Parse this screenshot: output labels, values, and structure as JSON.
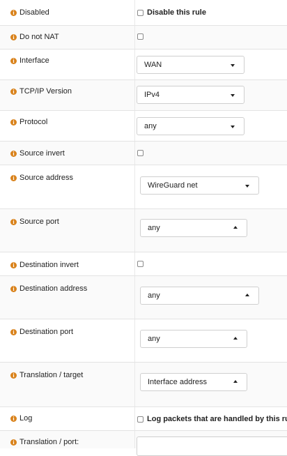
{
  "rules": {
    "disabled": {
      "label": "Disabled",
      "checkbox_label": "Disable this rule"
    },
    "do_not_nat": {
      "label": "Do not NAT"
    },
    "interface": {
      "label": "Interface",
      "value": "WAN"
    },
    "tcpip_version": {
      "label": "TCP/IP Version",
      "value": "IPv4"
    },
    "protocol": {
      "label": "Protocol",
      "value": "any"
    },
    "source_invert": {
      "label": "Source invert"
    },
    "source_address": {
      "label": "Source address",
      "value": "WireGuard net"
    },
    "source_port": {
      "label": "Source port",
      "value": "any"
    },
    "destination_invert": {
      "label": "Destination invert"
    },
    "destination_address": {
      "label": "Destination address",
      "value": "any"
    },
    "destination_port": {
      "label": "Destination port",
      "value": "any"
    },
    "translation_target": {
      "label": "Translation / target",
      "value": "Interface address"
    },
    "log": {
      "label": "Log",
      "checkbox_label": "Log packets that are handled by this rule"
    },
    "translation_port": {
      "label": "Translation / port:",
      "value": ""
    }
  },
  "colors": {
    "info_icon": "#d9821b",
    "border": "#cfcfcf"
  },
  "icons": {
    "info": "info-icon",
    "caret_down": "caret-down-icon",
    "caret_up": "caret-up-icon"
  }
}
